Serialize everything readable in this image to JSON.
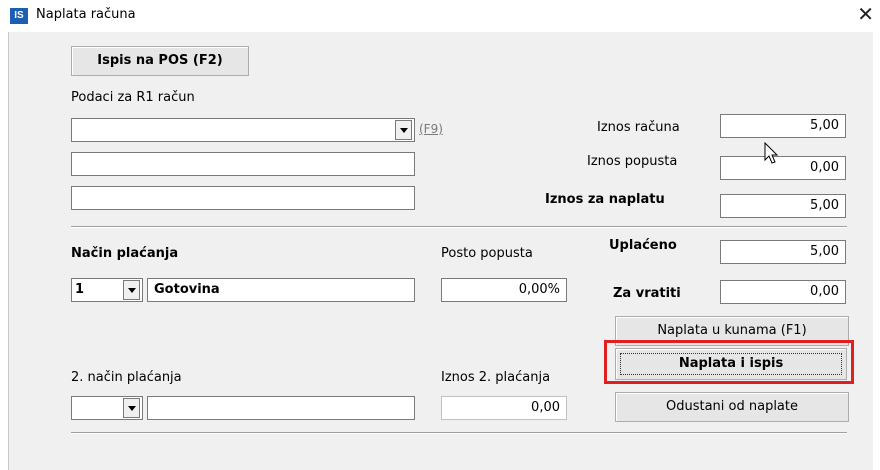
{
  "window": {
    "app_icon_text": "IS",
    "title": "Naplata računa",
    "close_symbol": "✕"
  },
  "print_pos_button": "Ispis na POS (F2)",
  "r1": {
    "label": "Podaci za R1 račun",
    "customer_value": "",
    "line2_value": "",
    "line3_value": "",
    "f9_link": "(F9)"
  },
  "amounts": {
    "invoice_label": "Iznos računa",
    "invoice_value": "5,00",
    "discount_label": "Iznos popusta",
    "discount_value": "0,00",
    "to_pay_label": "Iznos za naplatu",
    "to_pay_value": "5,00",
    "paid_label": "Uplaćeno",
    "paid_value": "5,00",
    "change_label": "Za vratiti",
    "change_value": "0,00"
  },
  "payment": {
    "method_label": "Način plaćanja",
    "method_code": "1",
    "method_name": "Gotovina",
    "discount_pct_label": "Posto popusta",
    "discount_pct_value": "0,00%",
    "method2_label": "2. način plaćanja",
    "method2_code": "",
    "method2_name": "",
    "amount2_label": "Iznos 2. plaćanja",
    "amount2_value": "0,00"
  },
  "actions": {
    "pay_kuna": "Naplata u kunama (F1)",
    "pay_print": "Naplata i ispis",
    "cancel": "Odustani od naplate"
  },
  "colors": {
    "highlight": "#e02020",
    "app_icon": "#1a5fb4"
  }
}
